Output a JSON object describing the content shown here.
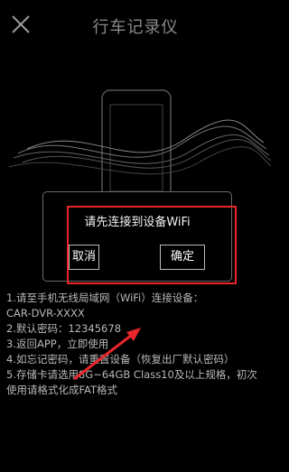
{
  "header": {
    "title": "行车记录仪",
    "close_icon": "close-icon"
  },
  "dialog": {
    "message": "请先连接到设备WiFi",
    "cancel_label": "取消",
    "ok_label": "确定"
  },
  "instructions": [
    "1.请至手机无线局域网（WiFi）连接设备：",
    "CAR-DVR-XXXX",
    "2.默认密码：12345678",
    "3.返回APP，立即使用",
    "4.如忘记密码，请重置设备（恢复出厂默认密码）",
    "5.存储卡请选用8G~64GB Class10及以上规格，初次使用请格式化成FAT格式"
  ],
  "annotation": {
    "highlight_color": "#e8262b"
  }
}
